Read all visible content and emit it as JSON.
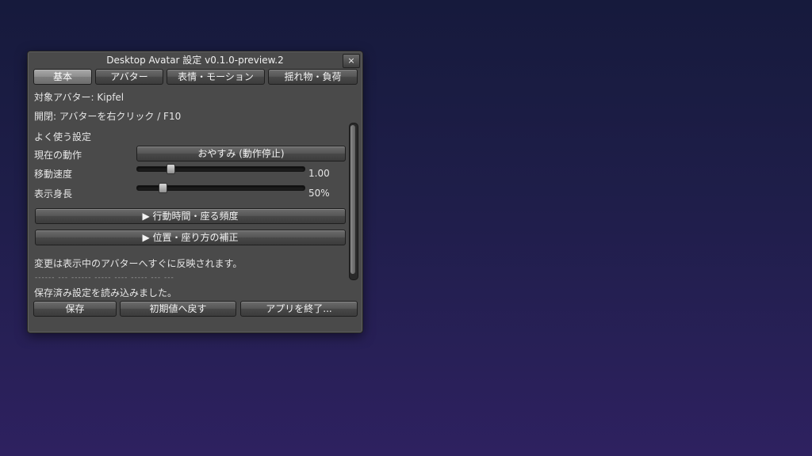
{
  "window": {
    "title": "Desktop Avatar 設定 v0.1.0-preview.2",
    "close_label": "×"
  },
  "tabs": [
    {
      "label": "基本",
      "selected": true
    },
    {
      "label": "アバター",
      "selected": false
    },
    {
      "label": "表情・モーション",
      "selected": false
    },
    {
      "label": "揺れ物・負荷",
      "selected": false
    }
  ],
  "info": {
    "target_avatar": "対象アバター: Kipfel",
    "open_hint": "開閉: アバターを右クリック / F10"
  },
  "frequent": {
    "heading": "よく使う設定",
    "current_action_label": "現在の動作",
    "current_action_value": "おやすみ (動作停止)",
    "move_speed_label": "移動速度",
    "move_speed_value": "1.00",
    "move_speed_fraction": 0.2,
    "display_height_label": "表示身長",
    "display_height_value": "50%",
    "display_height_fraction": 0.15
  },
  "sections": {
    "action_time": "▶ 行動時間・座る頻度",
    "position_fix": "▶ 位置・座り方の補正"
  },
  "notes": {
    "reflect_note": "変更は表示中のアバターへすぐに反映されます。",
    "dashes": "------ --- ------ ----- ---- ----- --- ---",
    "status": "保存済み設定を読み込みました。"
  },
  "footer": {
    "save": "保存",
    "reset": "初期値へ戻す",
    "quit": "アプリを終了..."
  }
}
